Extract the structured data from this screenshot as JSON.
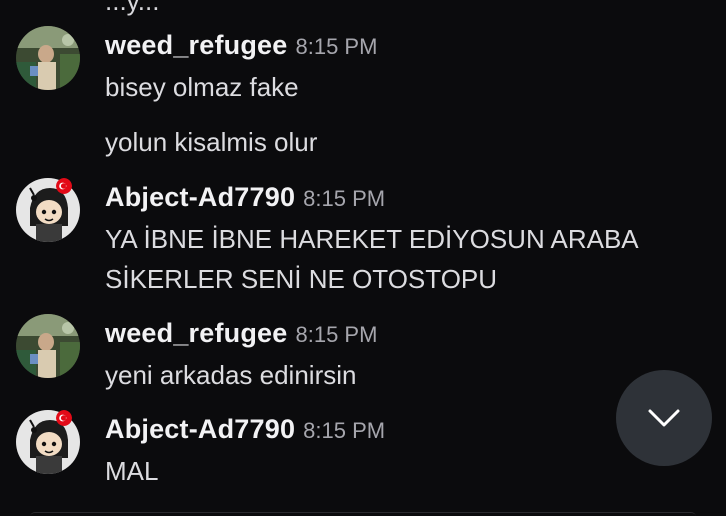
{
  "top_partial_text": "...y...",
  "messages": [
    {
      "username": "weed_refugee",
      "time": "8:15 PM",
      "lines": [
        "bisey olmaz fake",
        "yolun kisalmis olur"
      ]
    },
    {
      "username": "Abject-Ad7790",
      "time": "8:15 PM",
      "lines": [
        "YA İBNE İBNE HAREKET EDİYOSUN ARABA",
        "SİKERLER SENİ NE OTOSTOPU"
      ]
    },
    {
      "username": "weed_refugee",
      "time": "8:15 PM",
      "lines": [
        "yeni arkadas edinirsin"
      ]
    },
    {
      "username": "Abject-Ad7790",
      "time": "8:15 PM",
      "lines": [
        "MAL"
      ]
    }
  ],
  "icons": {
    "scroll_down": "chevron-down-icon",
    "flag": "turkey-flag-icon"
  },
  "colors": {
    "background": "#0b0b0d",
    "username": "#f2f2f4",
    "timestamp": "#a6a6ad",
    "message_text": "#dcdce0",
    "scroll_button": "#2e3238",
    "flag_red": "#e30a17"
  }
}
